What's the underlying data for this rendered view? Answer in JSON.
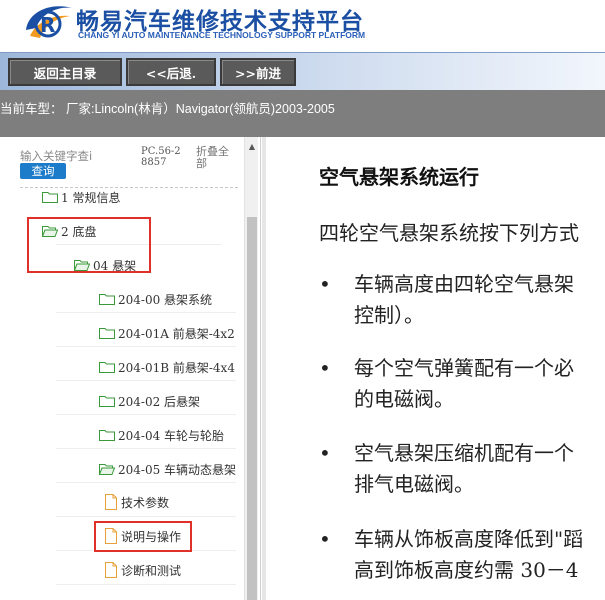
{
  "header": {
    "title": "畅易汽车维修技术支持平台",
    "subtitle": "CHANG YI AUTO MAINTENANCE TECHNOLOGY SUPPORT PLATFORM"
  },
  "toolbar": {
    "home_label": "返回主目录",
    "back_label": "<<后退.",
    "forward_label": ">>前进"
  },
  "car_info": {
    "text": "当前车型： 厂家:Lincoln(林肯）Navigator(领航员)2003-2005"
  },
  "sidebar": {
    "search_placeholder": "输入关键字查i",
    "search_button": "查询",
    "pc_code": "PC.56-28857",
    "collapse_all": "折叠全部",
    "tree": [
      {
        "label": "1 常规信息",
        "icon": "folder-icon",
        "state": "closed"
      },
      {
        "label": "2 底盘",
        "icon": "folder-open-icon",
        "state": "open",
        "highlighted": true
      },
      {
        "label": "04 悬架",
        "icon": "folder-open-icon",
        "state": "open",
        "highlighted": true
      },
      {
        "label": "204-00 悬架系统",
        "icon": "folder-icon",
        "state": "closed"
      },
      {
        "label": "204-01A 前悬架-4x2",
        "icon": "folder-icon",
        "state": "closed"
      },
      {
        "label": "204-01B 前悬架-4x4",
        "icon": "folder-icon",
        "state": "closed"
      },
      {
        "label": "204-02 后悬架",
        "icon": "folder-icon",
        "state": "closed"
      },
      {
        "label": "204-04 车轮与轮胎",
        "icon": "folder-icon",
        "state": "closed"
      },
      {
        "label": "204-05 车辆动态悬架",
        "icon": "folder-open-icon",
        "state": "open"
      },
      {
        "label": "技术参数",
        "icon": "document-icon"
      },
      {
        "label": "说明与操作",
        "icon": "document-icon",
        "highlighted": true,
        "selected": true
      },
      {
        "label": "诊断和测试",
        "icon": "document-icon"
      }
    ]
  },
  "article": {
    "title": "空气悬架系统运行",
    "intro": "四轮空气悬架系统按下列方式",
    "bullets": [
      {
        "line1": "车辆高度由四轮空气悬架",
        "line2": "控制）。"
      },
      {
        "line1": "每个空气弹簧配有一个必",
        "line2": "的电磁阀。"
      },
      {
        "line1": "空气悬架压缩机配有一个",
        "line2": "排气电磁阀。"
      },
      {
        "line1": "车辆从饰板高度降低到\"蹈",
        "line2": "高到饰板高度约需 30－4"
      }
    ]
  },
  "colors": {
    "brand_blue": "#1b4fa3",
    "toolbar_button": "#5a5a5a",
    "car_bar": "#7e7e7e",
    "highlight_red": "#e0302a",
    "search_button": "#1d7cc9",
    "folder_green": "#3a9a3a",
    "document_orange": "#e8a13a"
  }
}
